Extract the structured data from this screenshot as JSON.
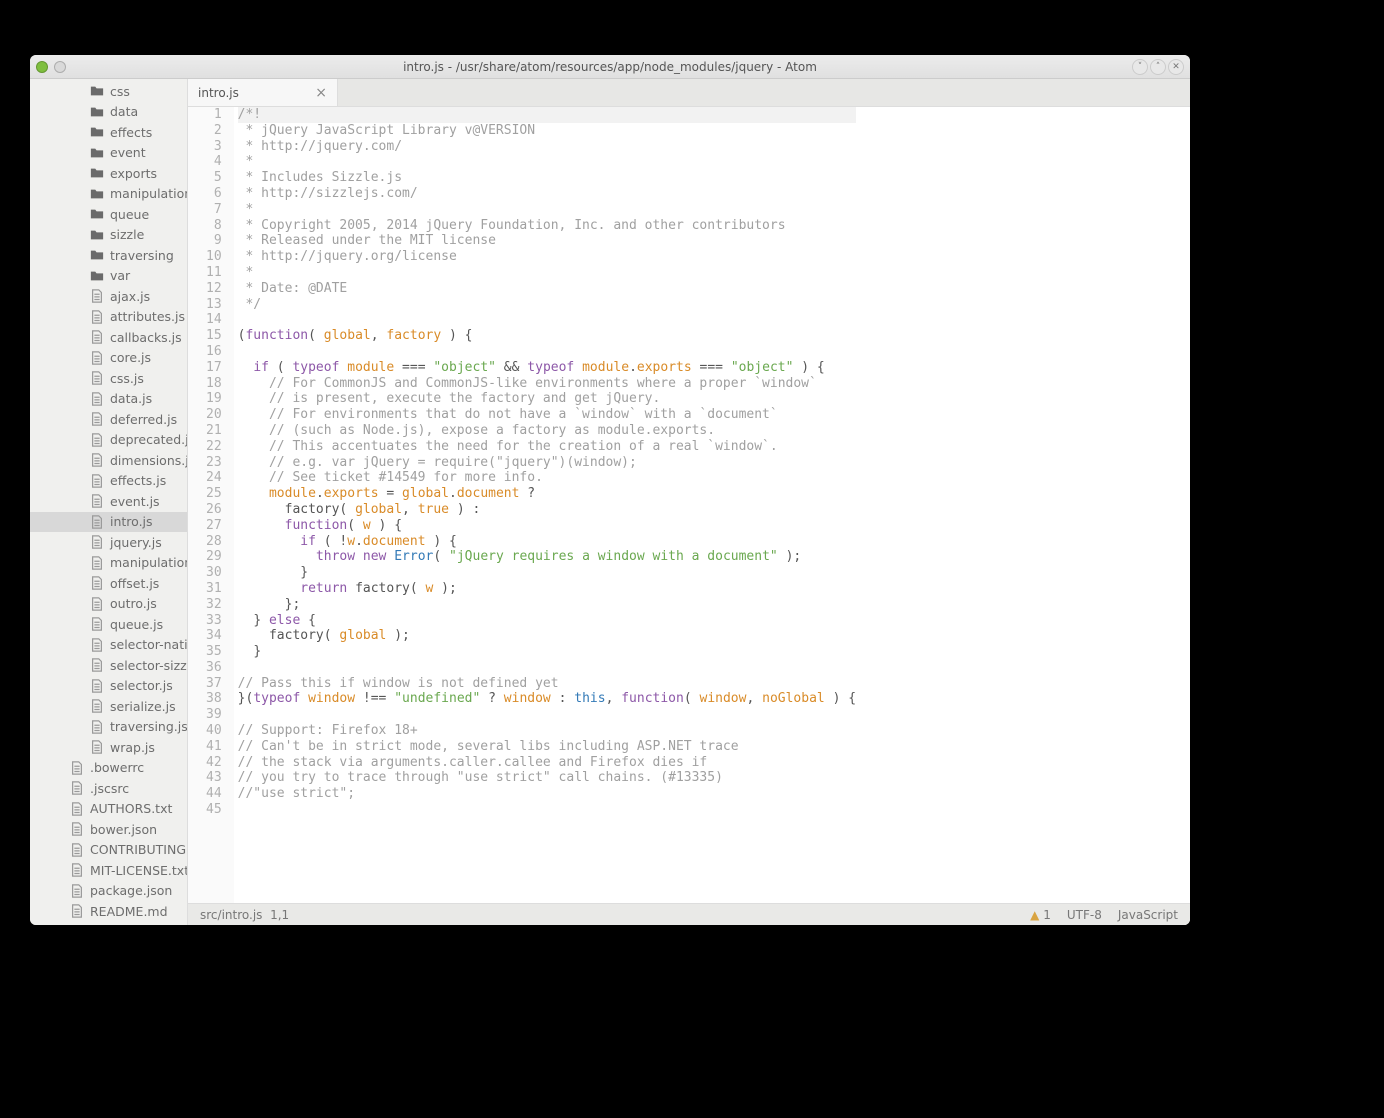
{
  "window": {
    "title": "intro.js - /usr/share/atom/resources/app/node_modules/jquery - Atom"
  },
  "sidebar": {
    "items": [
      {
        "type": "folder",
        "depth": 2,
        "label": "css"
      },
      {
        "type": "folder",
        "depth": 2,
        "label": "data"
      },
      {
        "type": "folder",
        "depth": 2,
        "label": "effects"
      },
      {
        "type": "folder",
        "depth": 2,
        "label": "event"
      },
      {
        "type": "folder",
        "depth": 2,
        "label": "exports"
      },
      {
        "type": "folder",
        "depth": 2,
        "label": "manipulation"
      },
      {
        "type": "folder",
        "depth": 2,
        "label": "queue"
      },
      {
        "type": "folder",
        "depth": 2,
        "label": "sizzle"
      },
      {
        "type": "folder",
        "depth": 2,
        "label": "traversing"
      },
      {
        "type": "folder",
        "depth": 2,
        "label": "var"
      },
      {
        "type": "file",
        "depth": 2,
        "label": "ajax.js"
      },
      {
        "type": "file",
        "depth": 2,
        "label": "attributes.js"
      },
      {
        "type": "file",
        "depth": 2,
        "label": "callbacks.js"
      },
      {
        "type": "file",
        "depth": 2,
        "label": "core.js"
      },
      {
        "type": "file",
        "depth": 2,
        "label": "css.js"
      },
      {
        "type": "file",
        "depth": 2,
        "label": "data.js"
      },
      {
        "type": "file",
        "depth": 2,
        "label": "deferred.js"
      },
      {
        "type": "file",
        "depth": 2,
        "label": "deprecated.js"
      },
      {
        "type": "file",
        "depth": 2,
        "label": "dimensions.js"
      },
      {
        "type": "file",
        "depth": 2,
        "label": "effects.js"
      },
      {
        "type": "file",
        "depth": 2,
        "label": "event.js"
      },
      {
        "type": "file",
        "depth": 2,
        "label": "intro.js",
        "selected": true
      },
      {
        "type": "file",
        "depth": 2,
        "label": "jquery.js"
      },
      {
        "type": "file",
        "depth": 2,
        "label": "manipulation.js"
      },
      {
        "type": "file",
        "depth": 2,
        "label": "offset.js"
      },
      {
        "type": "file",
        "depth": 2,
        "label": "outro.js"
      },
      {
        "type": "file",
        "depth": 2,
        "label": "queue.js"
      },
      {
        "type": "file",
        "depth": 2,
        "label": "selector-native.js"
      },
      {
        "type": "file",
        "depth": 2,
        "label": "selector-sizzle.js"
      },
      {
        "type": "file",
        "depth": 2,
        "label": "selector.js"
      },
      {
        "type": "file",
        "depth": 2,
        "label": "serialize.js"
      },
      {
        "type": "file",
        "depth": 2,
        "label": "traversing.js"
      },
      {
        "type": "file",
        "depth": 2,
        "label": "wrap.js"
      },
      {
        "type": "file",
        "depth": 1,
        "label": ".bowerrc"
      },
      {
        "type": "file",
        "depth": 1,
        "label": ".jscsrc"
      },
      {
        "type": "file",
        "depth": 1,
        "label": "AUTHORS.txt"
      },
      {
        "type": "file",
        "depth": 1,
        "label": "bower.json"
      },
      {
        "type": "file",
        "depth": 1,
        "label": "CONTRIBUTING.md"
      },
      {
        "type": "file",
        "depth": 1,
        "label": "MIT-LICENSE.txt"
      },
      {
        "type": "file",
        "depth": 1,
        "label": "package.json"
      },
      {
        "type": "file",
        "depth": 1,
        "label": "README.md"
      }
    ]
  },
  "tabs": {
    "active": {
      "label": "intro.js",
      "close": "×"
    }
  },
  "editor": {
    "lines": [
      [
        [
          "hl-comment",
          "/*!"
        ]
      ],
      [
        [
          "hl-comment",
          " * jQuery JavaScript Library v@VERSION"
        ]
      ],
      [
        [
          "hl-comment",
          " * http://jquery.com/"
        ]
      ],
      [
        [
          "hl-comment",
          " *"
        ]
      ],
      [
        [
          "hl-comment",
          " * Includes Sizzle.js"
        ]
      ],
      [
        [
          "hl-comment",
          " * http://sizzlejs.com/"
        ]
      ],
      [
        [
          "hl-comment",
          " *"
        ]
      ],
      [
        [
          "hl-comment",
          " * Copyright 2005, 2014 jQuery Foundation, Inc. and other contributors"
        ]
      ],
      [
        [
          "hl-comment",
          " * Released under the MIT license"
        ]
      ],
      [
        [
          "hl-comment",
          " * http://jquery.org/license"
        ]
      ],
      [
        [
          "hl-comment",
          " *"
        ]
      ],
      [
        [
          "hl-comment",
          " * Date: @DATE"
        ]
      ],
      [
        [
          "hl-comment",
          " */"
        ]
      ],
      [
        [
          "",
          ""
        ]
      ],
      [
        [
          "hl-punct",
          "("
        ],
        [
          "hl-keyword",
          "function"
        ],
        [
          "hl-punct",
          "( "
        ],
        [
          "hl-ident",
          "global"
        ],
        [
          "hl-punct",
          ", "
        ],
        [
          "hl-ident",
          "factory"
        ],
        [
          "hl-punct",
          " ) {"
        ]
      ],
      [
        [
          "",
          ""
        ]
      ],
      [
        [
          "",
          "  "
        ],
        [
          "hl-keyword",
          "if"
        ],
        [
          "hl-punct",
          " ( "
        ],
        [
          "hl-keyword",
          "typeof"
        ],
        [
          "hl-punct",
          " "
        ],
        [
          "hl-ident",
          "module"
        ],
        [
          "hl-punct",
          " === "
        ],
        [
          "hl-string",
          "\"object\""
        ],
        [
          "hl-punct",
          " && "
        ],
        [
          "hl-keyword",
          "typeof"
        ],
        [
          "hl-punct",
          " "
        ],
        [
          "hl-ident",
          "module"
        ],
        [
          "hl-punct",
          "."
        ],
        [
          "hl-ident",
          "exports"
        ],
        [
          "hl-punct",
          " === "
        ],
        [
          "hl-string",
          "\"object\""
        ],
        [
          "hl-punct",
          " ) {"
        ]
      ],
      [
        [
          "",
          "    "
        ],
        [
          "hl-comment",
          "// For CommonJS and CommonJS-like environments where a proper `window`"
        ]
      ],
      [
        [
          "",
          "    "
        ],
        [
          "hl-comment",
          "// is present, execute the factory and get jQuery."
        ]
      ],
      [
        [
          "",
          "    "
        ],
        [
          "hl-comment",
          "// For environments that do not have a `window` with a `document`"
        ]
      ],
      [
        [
          "",
          "    "
        ],
        [
          "hl-comment",
          "// (such as Node.js), expose a factory as module.exports."
        ]
      ],
      [
        [
          "",
          "    "
        ],
        [
          "hl-comment",
          "// This accentuates the need for the creation of a real `window`."
        ]
      ],
      [
        [
          "",
          "    "
        ],
        [
          "hl-comment",
          "// e.g. var jQuery = require(\"jquery\")(window);"
        ]
      ],
      [
        [
          "",
          "    "
        ],
        [
          "hl-comment",
          "// See ticket #14549 for more info."
        ]
      ],
      [
        [
          "",
          "    "
        ],
        [
          "hl-ident",
          "module"
        ],
        [
          "hl-punct",
          "."
        ],
        [
          "hl-ident",
          "exports"
        ],
        [
          "hl-punct",
          " = "
        ],
        [
          "hl-ident",
          "global"
        ],
        [
          "hl-punct",
          "."
        ],
        [
          "hl-ident",
          "document"
        ],
        [
          "hl-punct",
          " ?"
        ]
      ],
      [
        [
          "",
          "      "
        ],
        [
          "hl-punct",
          "factory( "
        ],
        [
          "hl-ident",
          "global"
        ],
        [
          "hl-punct",
          ", "
        ],
        [
          "hl-bool",
          "true"
        ],
        [
          "hl-punct",
          " ) :"
        ]
      ],
      [
        [
          "",
          "      "
        ],
        [
          "hl-keyword",
          "function"
        ],
        [
          "hl-punct",
          "( "
        ],
        [
          "hl-ident",
          "w"
        ],
        [
          "hl-punct",
          " ) {"
        ]
      ],
      [
        [
          "",
          "        "
        ],
        [
          "hl-keyword",
          "if"
        ],
        [
          "hl-punct",
          " ( !"
        ],
        [
          "hl-ident",
          "w"
        ],
        [
          "hl-punct",
          "."
        ],
        [
          "hl-ident",
          "document"
        ],
        [
          "hl-punct",
          " ) {"
        ]
      ],
      [
        [
          "",
          "          "
        ],
        [
          "hl-keyword",
          "throw"
        ],
        [
          "hl-punct",
          " "
        ],
        [
          "hl-keyword",
          "new"
        ],
        [
          "hl-punct",
          " "
        ],
        [
          "hl-builtin",
          "Error"
        ],
        [
          "hl-punct",
          "( "
        ],
        [
          "hl-string",
          "\"jQuery requires a window with a document\""
        ],
        [
          "hl-punct",
          " );"
        ]
      ],
      [
        [
          "",
          "        "
        ],
        [
          "hl-punct",
          "}"
        ]
      ],
      [
        [
          "",
          "        "
        ],
        [
          "hl-keyword",
          "return"
        ],
        [
          "hl-punct",
          " factory( "
        ],
        [
          "hl-ident",
          "w"
        ],
        [
          "hl-punct",
          " );"
        ]
      ],
      [
        [
          "",
          "      "
        ],
        [
          "hl-punct",
          "};"
        ]
      ],
      [
        [
          "",
          "  "
        ],
        [
          "hl-punct",
          "} "
        ],
        [
          "hl-keyword",
          "else"
        ],
        [
          "hl-punct",
          " {"
        ]
      ],
      [
        [
          "",
          "    "
        ],
        [
          "hl-punct",
          "factory( "
        ],
        [
          "hl-ident",
          "global"
        ],
        [
          "hl-punct",
          " );"
        ]
      ],
      [
        [
          "",
          "  "
        ],
        [
          "hl-punct",
          "}"
        ]
      ],
      [
        [
          "",
          ""
        ]
      ],
      [
        [
          "hl-comment",
          "// Pass this if window is not defined yet"
        ]
      ],
      [
        [
          "hl-punct",
          "}("
        ],
        [
          "hl-keyword",
          "typeof"
        ],
        [
          "hl-punct",
          " "
        ],
        [
          "hl-ident",
          "window"
        ],
        [
          "hl-punct",
          " !== "
        ],
        [
          "hl-string",
          "\"undefined\""
        ],
        [
          "hl-punct",
          " ? "
        ],
        [
          "hl-ident",
          "window"
        ],
        [
          "hl-punct",
          " : "
        ],
        [
          "hl-builtin",
          "this"
        ],
        [
          "hl-punct",
          ", "
        ],
        [
          "hl-keyword",
          "function"
        ],
        [
          "hl-punct",
          "( "
        ],
        [
          "hl-ident",
          "window"
        ],
        [
          "hl-punct",
          ", "
        ],
        [
          "hl-ident",
          "noGlobal"
        ],
        [
          "hl-punct",
          " ) {"
        ]
      ],
      [
        [
          "",
          ""
        ]
      ],
      [
        [
          "hl-comment",
          "// Support: Firefox 18+"
        ]
      ],
      [
        [
          "hl-comment",
          "// Can't be in strict mode, several libs including ASP.NET trace"
        ]
      ],
      [
        [
          "hl-comment",
          "// the stack via arguments.caller.callee and Firefox dies if"
        ]
      ],
      [
        [
          "hl-comment",
          "// you try to trace through \"use strict\" call chains. (#13335)"
        ]
      ],
      [
        [
          "hl-comment",
          "//\"use strict\";"
        ]
      ],
      [
        [
          "",
          ""
        ]
      ]
    ]
  },
  "statusbar": {
    "path": "src/intro.js",
    "position": "1,1",
    "warnings": "1",
    "encoding": "UTF-8",
    "language": "JavaScript"
  }
}
